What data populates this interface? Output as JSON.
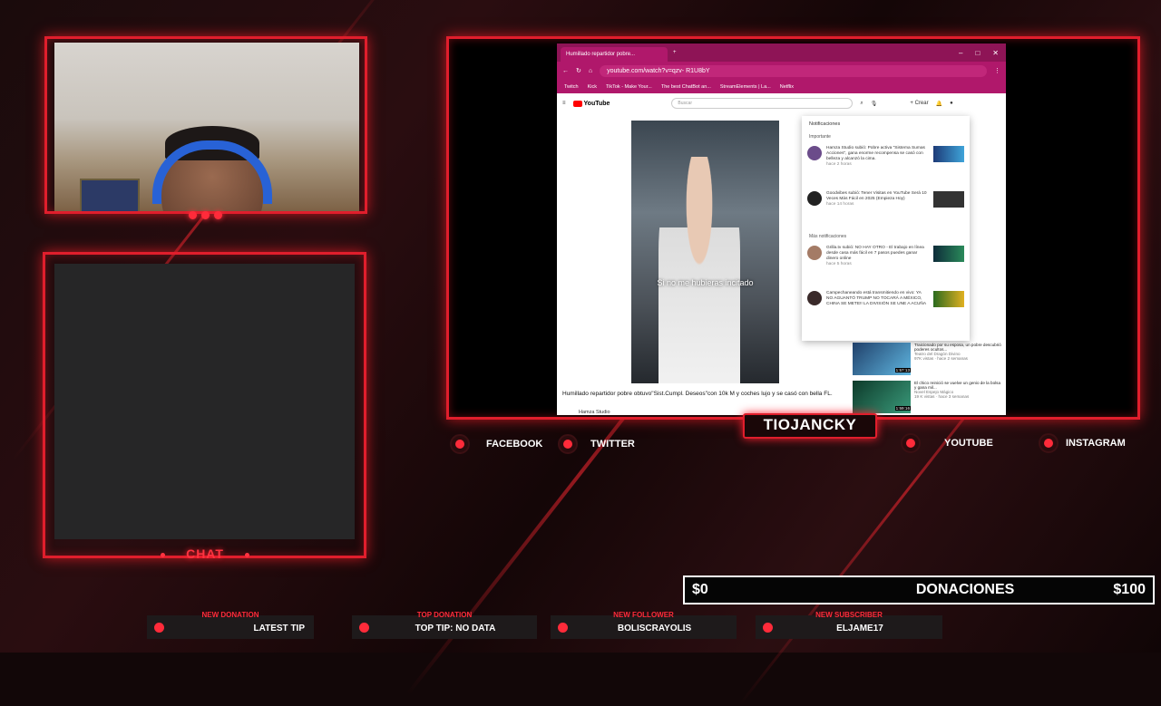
{
  "overlay": {
    "chat_label": "CHAT",
    "streamer_handle": "TIOJANCKY",
    "socials": [
      {
        "label": "FACEBOOK"
      },
      {
        "label": "TWITTER"
      },
      {
        "label": "YOUTUBE"
      },
      {
        "label": "INSTAGRAM"
      }
    ],
    "goal": {
      "current": "$0",
      "label": "DONACIONES",
      "target": "$100"
    },
    "alerts": [
      {
        "label": "NEW DONATION",
        "value": "LATEST TIP"
      },
      {
        "label": "TOP DONATION",
        "value": "TOP TIP: NO DATA"
      },
      {
        "label": "NEW FOLLOWER",
        "value": "BOLISCRAYOLIS"
      },
      {
        "label": "NEW SUBSCRIBER",
        "value": "ELJAME17"
      }
    ],
    "accent": "#e01e2c"
  },
  "browser": {
    "tab_title": "Humillado repartidor pobre...",
    "url": "youtube.com/watch?v=qzv- R1U8bY",
    "bookmarks": [
      "Twitch",
      "Kick",
      "TikTok - Make Your...",
      "The best ChatBot an...",
      "StreamElements | La...",
      "Netflix"
    ],
    "yt": {
      "search_placeholder": "Buscar",
      "create_label": "Crear",
      "subtitle": "Si no me hubieras incitado",
      "video_title": "Humillado repartidor pobre obtuvo\"Sist.Cumpl. Deseos\"con 10k M y coches lujo y se casó con bella FL.",
      "channel": "Hamza Studio",
      "notifications": {
        "title": "Notificaciones",
        "important_label": "Importante",
        "more_label": "Más notificaciones",
        "items": [
          {
            "text": "Hamza Studio subió: Pobre activa \"Sistema Sumas Acciones\", gana enorme recompensa se casó con belleza y alcanzó la cima.",
            "time": "hace 2 horas"
          },
          {
            "text": "Goodvibes subió: Tener Visitas en YouTube Será 10 Veces Más Fácil en 2025 (Empieza Hoy)",
            "time": "hace 14 horas"
          },
          {
            "text": "Grilla.tv subió: NO HAY OTRO - El trabajo en línea desde casa más fácil en 7 pasos puedes ganar dinero online",
            "time": "hace 5 horas"
          },
          {
            "text": "Campechaneando está transmitiendo en vivo: YA NO AGUANTÓ TRUMP NO TOCARÁ A MÉXICO, CHINA SE METE!! LA DIVISIÓN SE UNE A ACUÑA",
            "time": ""
          }
        ]
      },
      "sidebar": [
        {
          "title": "Traicionado por su esposa, un pobre descubrió poderes ocultos...",
          "channel": "Teatro del Dragón Divino",
          "meta": "97K vistas · hace 2 semanas",
          "duration": "1:57:13"
        },
        {
          "title": "El chico reinició se vuelve un genio de la bolsa y gana mil...",
          "channel": "Novel Espejo Mágico",
          "meta": "19 K vistas · hace 3 semanas",
          "duration": "1:59:16"
        }
      ]
    }
  }
}
